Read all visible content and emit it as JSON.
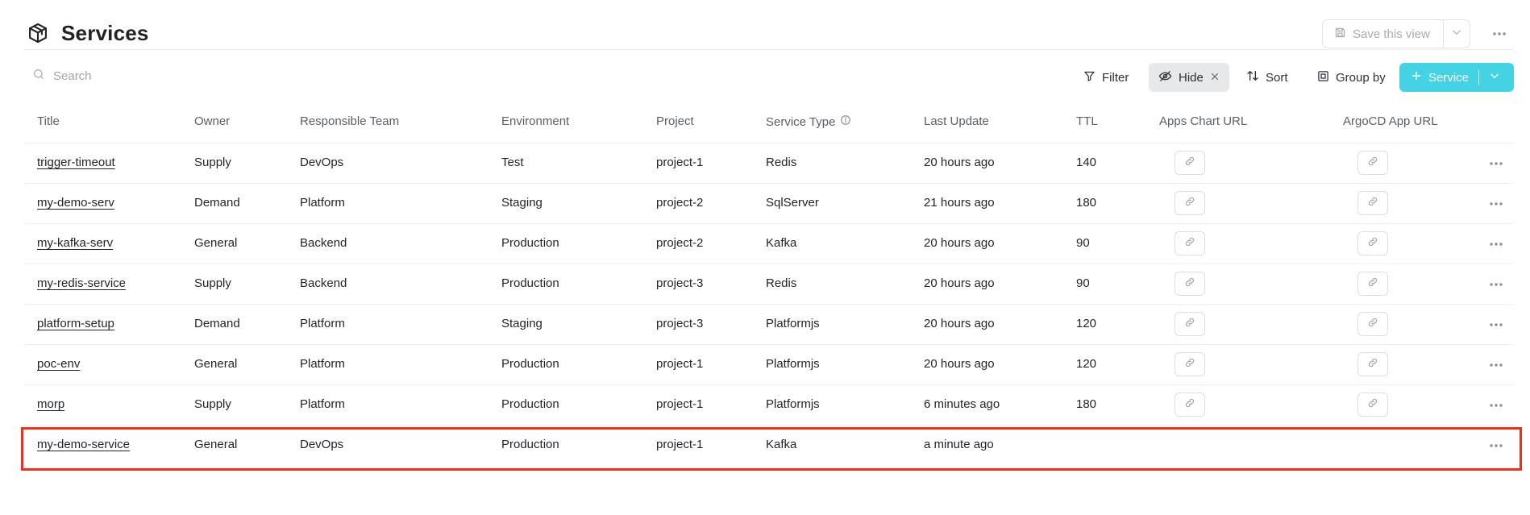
{
  "header": {
    "title": "Services",
    "save_view_label": "Save this view"
  },
  "toolbar": {
    "search_placeholder": "Search",
    "filter_label": "Filter",
    "hide_label": "Hide",
    "sort_label": "Sort",
    "group_by_label": "Group by",
    "add_service_label": "Service"
  },
  "table": {
    "columns": [
      "Title",
      "Owner",
      "Responsible Team",
      "Environment",
      "Project",
      "Service Type",
      "Last Update",
      "TTL",
      "Apps Chart URL",
      "ArgoCD App URL"
    ],
    "rows": [
      {
        "title": "trigger-timeout",
        "owner": "Supply",
        "team": "DevOps",
        "environment": "Test",
        "project": "project-1",
        "service_type": "Redis",
        "last_update": "20 hours ago",
        "ttl": "140",
        "has_links": true
      },
      {
        "title": "my-demo-serv",
        "owner": "Demand",
        "team": "Platform",
        "environment": "Staging",
        "project": "project-2",
        "service_type": "SqlServer",
        "last_update": "21 hours ago",
        "ttl": "180",
        "has_links": true
      },
      {
        "title": "my-kafka-serv",
        "owner": "General",
        "team": "Backend",
        "environment": "Production",
        "project": "project-2",
        "service_type": "Kafka",
        "last_update": "20 hours ago",
        "ttl": "90",
        "has_links": true
      },
      {
        "title": "my-redis-service",
        "owner": "Supply",
        "team": "Backend",
        "environment": "Production",
        "project": "project-3",
        "service_type": "Redis",
        "last_update": "20 hours ago",
        "ttl": "90",
        "has_links": true
      },
      {
        "title": "platform-setup",
        "owner": "Demand",
        "team": "Platform",
        "environment": "Staging",
        "project": "project-3",
        "service_type": "Platformjs",
        "last_update": "20 hours ago",
        "ttl": "120",
        "has_links": true
      },
      {
        "title": "poc-env",
        "owner": "General",
        "team": "Platform",
        "environment": "Production",
        "project": "project-1",
        "service_type": "Platformjs",
        "last_update": "20 hours ago",
        "ttl": "120",
        "has_links": true
      },
      {
        "title": "morp",
        "owner": "Supply",
        "team": "Platform",
        "environment": "Production",
        "project": "project-1",
        "service_type": "Platformjs",
        "last_update": "6 minutes ago",
        "ttl": "180",
        "has_links": true
      },
      {
        "title": "my-demo-service",
        "owner": "General",
        "team": "DevOps",
        "environment": "Production",
        "project": "project-1",
        "service_type": "Kafka",
        "last_update": "a minute ago",
        "ttl": "",
        "has_links": false
      }
    ]
  },
  "colors": {
    "accent": "#44d3e4",
    "highlight": "#e8321c",
    "hide_bg": "#e7e8ea"
  }
}
